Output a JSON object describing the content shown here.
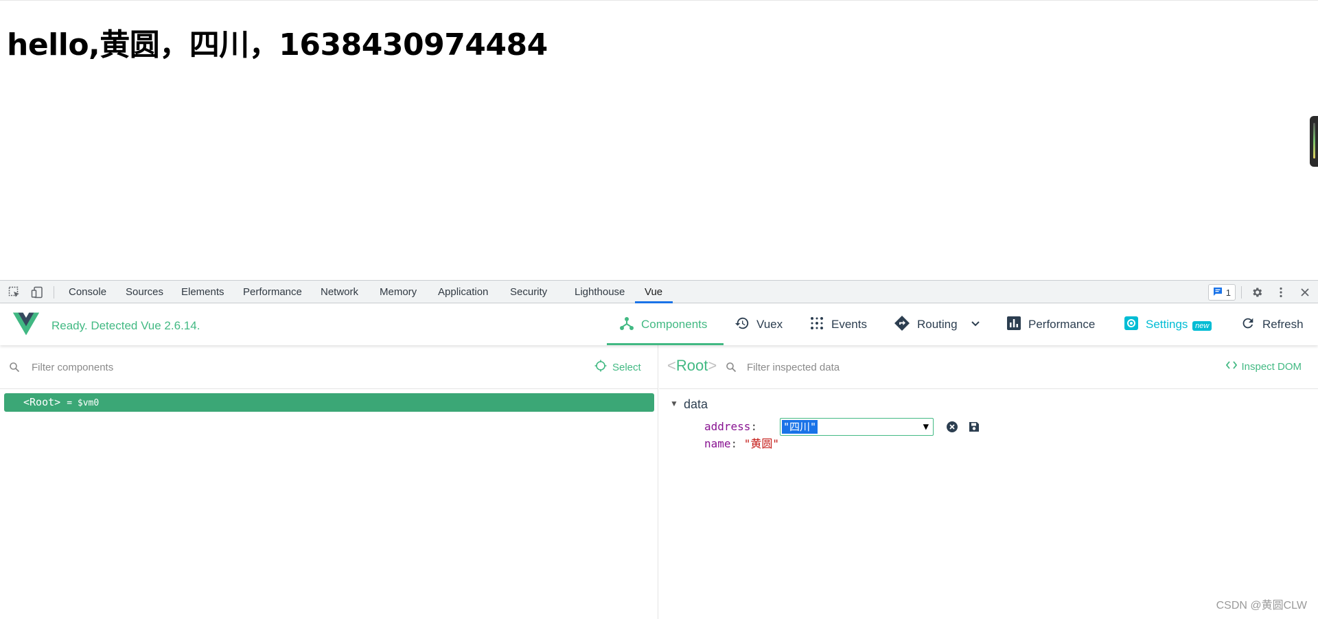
{
  "page": {
    "heading": "hello,黄圆，四川，1638430974484"
  },
  "devtools_tabs": [
    {
      "label": "Console"
    },
    {
      "label": "Sources"
    },
    {
      "label": "Elements"
    },
    {
      "label": "Performance"
    },
    {
      "label": "Network"
    },
    {
      "label": "Memory"
    },
    {
      "label": "Application"
    },
    {
      "label": "Security"
    },
    {
      "label": "Lighthouse"
    },
    {
      "label": "Vue",
      "active": true
    }
  ],
  "issues_badge": {
    "count": "1",
    "icon": "message-icon"
  },
  "vue_header": {
    "status": "Ready. Detected Vue 2.6.14.",
    "nav": {
      "components": "Components",
      "vuex": "Vuex",
      "events": "Events",
      "routing": "Routing",
      "performance": "Performance",
      "settings": "Settings",
      "settings_badge": "new",
      "refresh": "Refresh"
    },
    "colors": {
      "accent": "#42b983",
      "settings": "#00bcd4",
      "text": "#2c3e50"
    }
  },
  "component_tree": {
    "filter_placeholder": "Filter components",
    "select_label": "Select",
    "root_row": {
      "name": "Root",
      "alias": "= $vm0",
      "selected_color": "#3ba776"
    }
  },
  "inspector": {
    "title": "Root",
    "filter_placeholder": "Filter inspected data",
    "inspect_dom_label": "Inspect DOM",
    "section_label": "data",
    "props": {
      "address": {
        "key": "address",
        "value": "\"四川\""
      },
      "name": {
        "key": "name",
        "value": "\"黄圆\""
      }
    }
  },
  "watermark": "CSDN @黄圆CLW"
}
